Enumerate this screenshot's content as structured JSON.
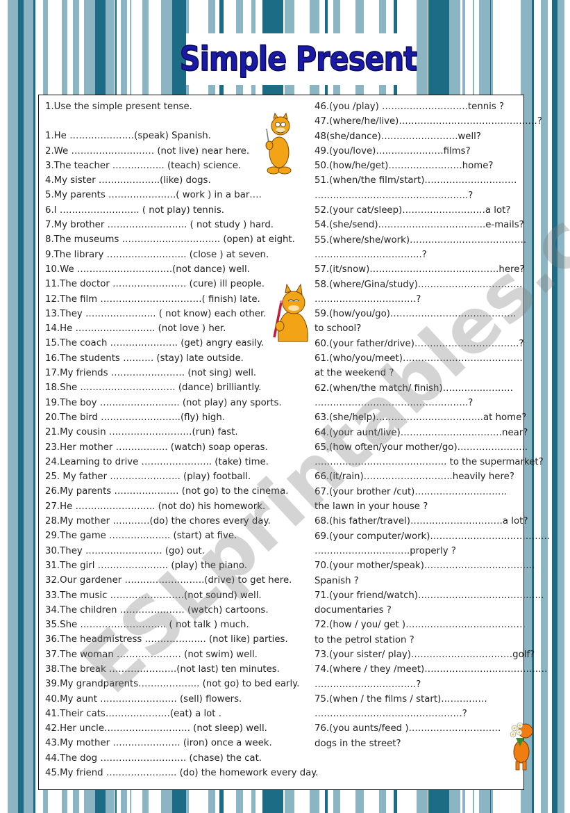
{
  "title": "Simple Present",
  "instruction": "1.Use the simple present tense.",
  "watermark": "ESLprintables.com",
  "colors": {
    "title": "#1a1aa8",
    "stripe_dark": "#1d6c86",
    "stripe_mid": "#8bb5c2",
    "stripe_light": "#b7d0d8",
    "garfield_orange": "#f2a416"
  },
  "left_items": [
    "1.He …………………(speak) Spanish.",
    "2.We ……………………… (not live) near here.",
    "3.The teacher …………….. (teach) science.",
    "4.My sister ………………..(like) dogs.",
    "5.My parents ………………….( work ) in a bar….",
    "6.I …………………….. ( not play) tennis.",
    "7.My  brother …………………….. ( not study ) hard.",
    "8.The museums ………………………….. (open) at eight.",
    "9.The library …………………….. (close ) at seven.",
    "10.We ………………………….(not dance) well.",
    "11.The doctor …………………… (cure) ill people.",
    "12.The film ……………………………( finish) late.",
    "13.They ………………….. ( not know) each other.",
    "14.He …………………….. (not love ) her.",
    "15.The coach …………………. (get) angry easily.",
    "16.The students ………. (stay) late outside.",
    "17.My friends …………………… (not sing) well.",
    "18.She …………………………. (dance) brilliantly.",
    "19.The boy …………………….. (not play) any sports.",
    "20.The bird ……………………..(fly) high.",
    "21.My cousin ………………………(run) fast.",
    "23.Her mother …………….. (watch) soap operas.",
    "24.Learning to drive ………………….. (take) time.",
    "25. My father ………………….. (play) football.",
    "26.My parents ………………… (not go) to the cinema.",
    "27.He …………………….. (not do) his homework.",
    "28.My mother …………(do) the chores every day.",
    "29.The game ……………….. (start) at five.",
    "30.They ……………………. (go) out.",
    "31.The girl ………………….. (play) the piano.",
    "32.Our gardener ……………………..(drive) to get here.",
    "33.The music ……………………(not sound) well.",
    "34.The children ………………… (watch) cartoons.",
    "35.She ………………………. ( not talk ) much.",
    "36.The headmistress ……………….. (not like) parties.",
    "37.The woman ………………… (not swim) well.",
    "38.The break ………………….(not last) ten minutes.",
    "39.My grandparents……………….. (not go) to bed early.",
    "40.My aunt ……………………. (sell) flowers.",
    "41.Their cats…………………(eat) a lot .",
    "42.Her uncle………………………. (not sleep) well.",
    "43.My mother …………………. (iron) once a week.",
    "44.The dog ………………………. (chase) the cat.",
    "45.My friend ………………….. (do) the homework every day."
  ],
  "right_items": [
    "46.(you /play)  ……………………….tennis ?",
    "47.(where/he/live)………………………………………?",
    "48(she/dance)…………………….well?",
    "49.(you/love)…………….……films?",
    "50.(how/he/get)……………………home?",
    "51.(when/the film/start)…………………………",
    "…………………………………………..?",
    "52.(your cat/sleep)………………………a lot?",
    "54.(she/send)……………………………..e-mails?",
    "55.(where/she/work)………………………………..",
    "……………………………..?",
    "57.(it/snow)……………………………………here?",
    "58.(where/Gina/study)…………………………….",
    "……………………………?",
    "59.(how/you/go)………………….……………….",
    "to school?",
    "60.(your father/drive)…………………………….?",
    "61.(who/you/meet)…………………………………",
    "at the weekend ?",
    "62.(when/the match/ finish)…………..………",
    "…………………………………………..?",
    "63.(she/help)……………………………..at home?",
    "64.(your aunt/live)……………………………near?",
    "65.(how often/your mother/go)…………………..",
    "……………………………………. to the supermarket?",
    "66.(it/rain)………………………..heavily here?",
    "67.(your brother /cut)…………………………",
    "the lawn in your house ?",
    "68.(his father/travel)…………………………a lot?",
    "69.(your computer/work)…………………………………",
    "………………………….properly ?",
    "70.(your mother/speak)………………………………",
    "Spanish ?",
    "71.(your friend/watch)…………………………………..",
    "documentaries ?",
    "72.(how / you/ get )…………………………………",
    "to the petrol station ?",
    "73.(your sister/ play)……………………………golf?",
    "74.(where / they /meet)………………………………….",
    "……………………………?",
    "75.(when / the films / start)……………",
    "…………………………………………?",
    "76.(you aunts/feed )…………………………",
    "dogs in the street?"
  ],
  "images": [
    {
      "name": "garfield-standing-pen-image",
      "description": "Garfield standing holding a pen"
    },
    {
      "name": "garfield-writing-image",
      "description": "Garfield writing with a red pencil"
    },
    {
      "name": "garfield-flowers-image",
      "description": "Garfield holding a bouquet of flowers"
    }
  ]
}
